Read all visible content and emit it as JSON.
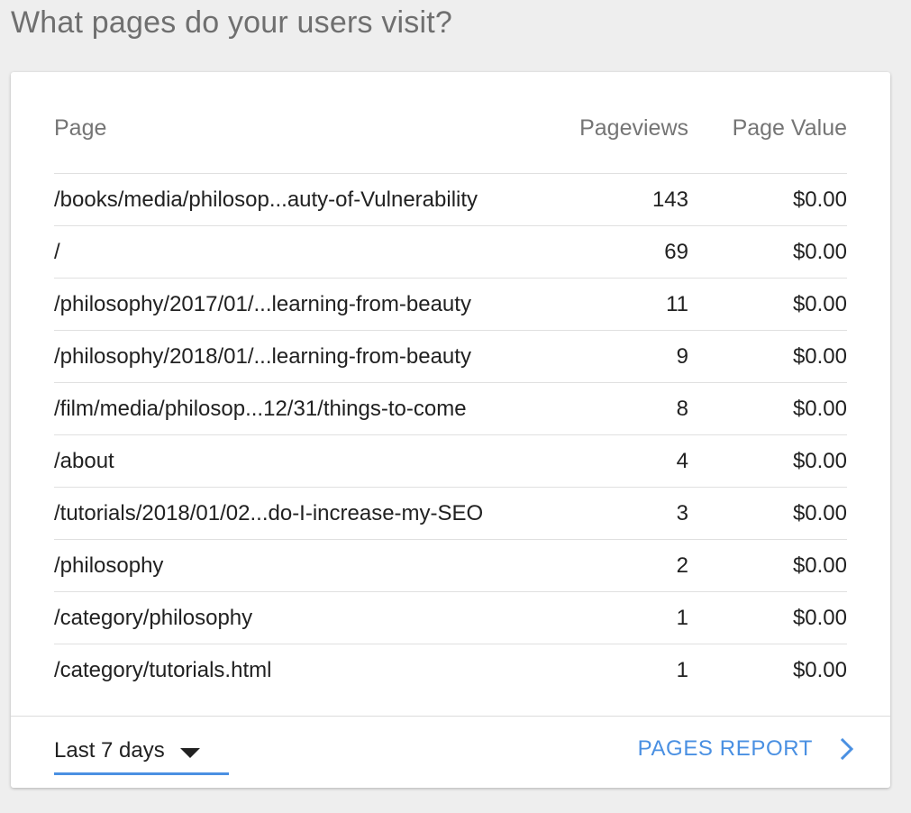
{
  "header": {
    "title": "What pages do your users visit?"
  },
  "table": {
    "columns": {
      "page": "Page",
      "pageviews": "Pageviews",
      "page_value": "Page Value"
    },
    "rows": [
      {
        "page": "/books/media/philosop...auty-of-Vulnerability",
        "pageviews": "143",
        "value": "$0.00"
      },
      {
        "page": "/",
        "pageviews": "69",
        "value": "$0.00"
      },
      {
        "page": "/philosophy/2017/01/...learning-from-beauty",
        "pageviews": "11",
        "value": "$0.00"
      },
      {
        "page": "/philosophy/2018/01/...learning-from-beauty",
        "pageviews": "9",
        "value": "$0.00"
      },
      {
        "page": "/film/media/philosop...12/31/things-to-come",
        "pageviews": "8",
        "value": "$0.00"
      },
      {
        "page": "/about",
        "pageviews": "4",
        "value": "$0.00"
      },
      {
        "page": "/tutorials/2018/01/02...do-I-increase-my-SEO",
        "pageviews": "3",
        "value": "$0.00"
      },
      {
        "page": "/philosophy",
        "pageviews": "2",
        "value": "$0.00"
      },
      {
        "page": "/category/philosophy",
        "pageviews": "1",
        "value": "$0.00"
      },
      {
        "page": "/category/tutorials.html",
        "pageviews": "1",
        "value": "$0.00"
      }
    ]
  },
  "footer": {
    "date_range": "Last 7 days",
    "report_link": "PAGES REPORT",
    "caret_icon": "caret-down-icon",
    "chevron_icon": "chevron-right-icon"
  },
  "colors": {
    "accent": "#4a90e2",
    "background": "#eeeeee",
    "card": "#ffffff",
    "text_primary": "#212121",
    "text_secondary": "#757575"
  }
}
